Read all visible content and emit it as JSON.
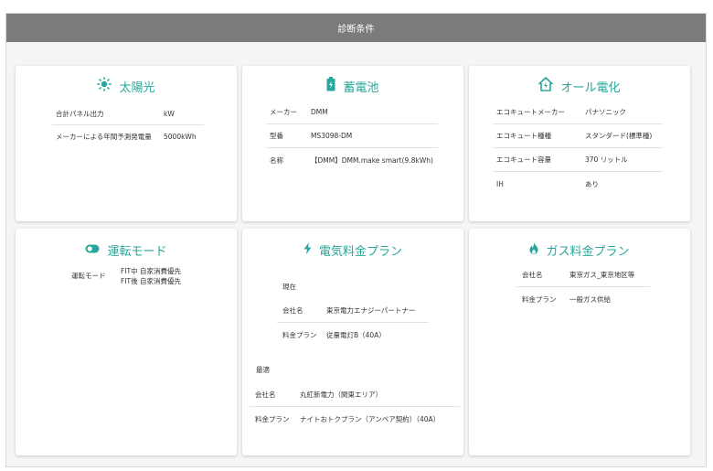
{
  "header": {
    "title": "診断条件"
  },
  "solar": {
    "title": "太陽光",
    "rows": [
      {
        "label": "合計パネル出力",
        "value": "kW"
      },
      {
        "label": "メーカーによる年間予測発電量",
        "value": "5000kWh"
      }
    ]
  },
  "battery": {
    "title": "蓄電池",
    "rows": [
      {
        "label": "メーカー",
        "value": "DMM"
      },
      {
        "label": "型番",
        "value": "MS3098-DM"
      },
      {
        "label": "名称",
        "value": "【DMM】DMM.make smart(9.8kWh)"
      }
    ]
  },
  "all_electric": {
    "title": "オール電化",
    "rows": [
      {
        "label": "エコキュートメーカー",
        "value": "パナソニック"
      },
      {
        "label": "エコキュート種種",
        "value": "スタンダード(標準種)"
      },
      {
        "label": "エコキュート容量",
        "value": "370 リットル"
      },
      {
        "label": "IH",
        "value": "あり"
      }
    ]
  },
  "mode": {
    "title": "運転モード",
    "label": "運転モード",
    "lines": [
      "FIT中 自家消費優先",
      "FIT後 自家消費優先"
    ]
  },
  "electric_plan": {
    "title": "電気料金プラン",
    "current_label": "現在",
    "current_rows": [
      {
        "label": "会社名",
        "value": "東京電力エナジーパートナー"
      },
      {
        "label": "料金プラン",
        "value": "従量電灯B（40A）"
      }
    ],
    "optimal_label": "最適",
    "optimal_rows": [
      {
        "label": "会社名",
        "value": "丸紅新電力（関東エリア）"
      },
      {
        "label": "料金プラン",
        "value": "ナイトおトクプラン（アンペア契約）（40A）"
      }
    ]
  },
  "gas_plan": {
    "title": "ガス料金プラン",
    "rows": [
      {
        "label": "会社名",
        "value": "東京ガス_東京地区等"
      },
      {
        "label": "料金プラン",
        "value": "一般ガス供給"
      }
    ]
  },
  "colors": {
    "accent": "#27a79b",
    "header_bg": "#7b7b7b",
    "panel_bg": "#f5f5f5"
  },
  "icons": {
    "solar": "sun-icon",
    "battery": "battery-icon",
    "all_electric": "house-plug-icon",
    "mode": "toggle-icon",
    "electric_plan": "lightning-icon",
    "gas_plan": "flame-icon"
  }
}
